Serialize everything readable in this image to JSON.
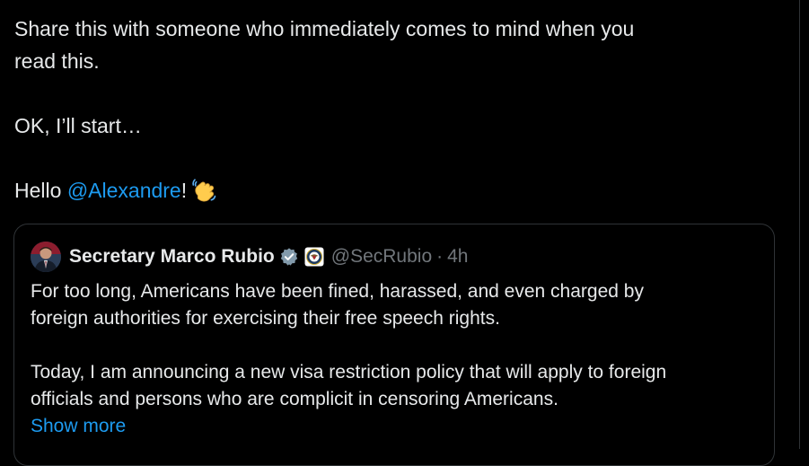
{
  "post": {
    "line1": "Share this with someone who immediately comes to mind when you",
    "line2": "read this.",
    "line3": "OK, I’ll start…",
    "hello": "Hello ",
    "mention": "@Alexandre",
    "after_mention": "!",
    "emoji": "waving-hand-icon"
  },
  "quote": {
    "author_name": "Secretary Marco Rubio",
    "handle": "@SecRubio",
    "separator": "·",
    "timestamp": "4h",
    "para1_line1": "For too long, Americans have been fined, harassed, and even charged by",
    "para1_line2": "foreign authorities for exercising their free speech rights.",
    "para2_line1": "Today, I am announcing a new visa restriction policy that will apply to foreign",
    "para2_line2": "officials and persons who are complicit in censoring Americans.",
    "show_more": "Show more"
  },
  "colors": {
    "background": "#000000",
    "text": "#e7e9ea",
    "muted": "#71767b",
    "link": "#1d9bf0",
    "border": "#2f3336",
    "verified": "#829aab"
  }
}
